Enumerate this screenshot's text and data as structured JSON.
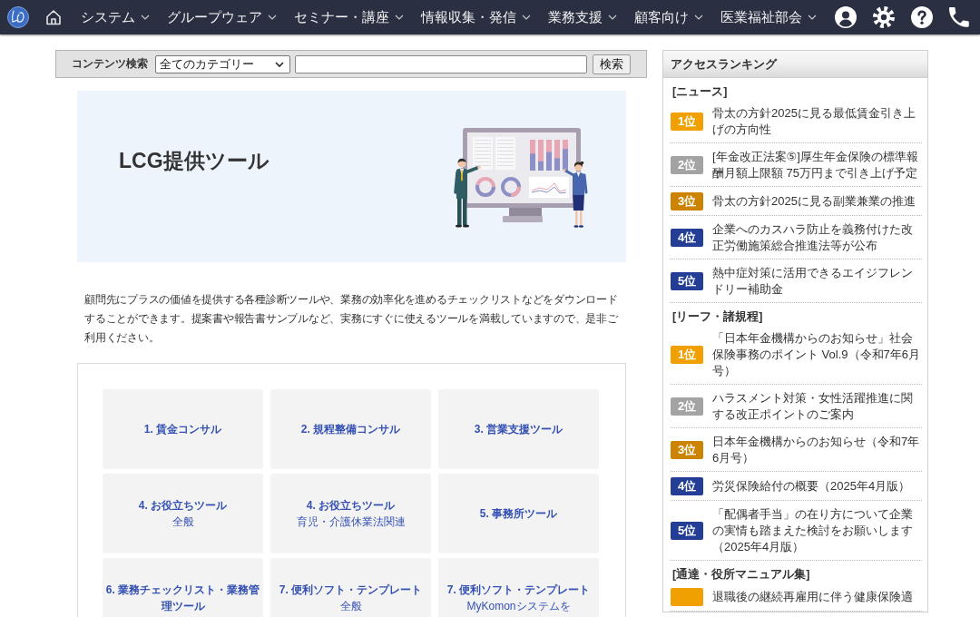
{
  "nav": {
    "items": [
      {
        "label": "システム"
      },
      {
        "label": "グループウェア"
      },
      {
        "label": "セミナー・講座"
      },
      {
        "label": "情報収集・発信"
      },
      {
        "label": "業務支援"
      },
      {
        "label": "顧客向け"
      },
      {
        "label": "医業福祉部会"
      }
    ]
  },
  "search": {
    "label": "コンテンツ検索",
    "category": "全てのカテゴリー",
    "button": "検索"
  },
  "hero": {
    "title": "LCG提供ツール"
  },
  "description": "顧問先にプラスの価値を提供する各種診断ツールや、業務の効率化を進めるチェックリストなどをダウンロードすることができます。提案書や報告書サンプルなど、実務にすぐに使えるツールを満載していますので、是非ご利用ください。",
  "tools": [
    {
      "title": "1. 賃金コンサル"
    },
    {
      "title": "2. 規程整備コンサル"
    },
    {
      "title": "3. 営業支援ツール"
    },
    {
      "title": "4. お役立ちツール",
      "subtitle": "全般"
    },
    {
      "title": "4. お役立ちツール",
      "subtitle": "育児・介護休業法関連"
    },
    {
      "title": "5. 事務所ツール"
    },
    {
      "title": "6. 業務チェックリスト・業務管理ツール"
    },
    {
      "title": "7. 便利ソフト・テンプレート",
      "subtitle": "全般"
    },
    {
      "title": "7. 便利ソフト・テンプレート",
      "subtitle": "MyKomonシステムを"
    }
  ],
  "ranking": {
    "title": "アクセスランキング",
    "sections": [
      {
        "heading": "[ニュース]",
        "items": [
          {
            "rank": "1位",
            "color": "#f0a000",
            "text": "骨太の方針2025に見る最低賃金引き上げの方向性"
          },
          {
            "rank": "2位",
            "color": "#a3a3a3",
            "text": "[年金改正法案⑤]厚生年金保険の標準報酬月額上限額 75万円まで引き上げ予定"
          },
          {
            "rank": "3位",
            "color": "#cc8400",
            "text": "骨太の方針2025に見る副業兼業の推進"
          },
          {
            "rank": "4位",
            "color": "#233e94",
            "text": "企業へのカスハラ防止を義務付けた改正労働施策総合推進法等が公布"
          },
          {
            "rank": "5位",
            "color": "#233e94",
            "text": "熱中症対策に活用できるエイジフレンドリー補助金"
          }
        ]
      },
      {
        "heading": "[リーフ・諸規程]",
        "items": [
          {
            "rank": "1位",
            "color": "#f0a000",
            "text": "「日本年金機構からのお知らせ」社会保険事務のポイント Vol.9（令和7年6月号）"
          },
          {
            "rank": "2位",
            "color": "#a3a3a3",
            "text": "ハラスメント対策・女性活躍推進に関する改正ポイントのご案内"
          },
          {
            "rank": "3位",
            "color": "#cc8400",
            "text": "日本年金機構からのお知らせ（令和7年6月号）"
          },
          {
            "rank": "4位",
            "color": "#233e94",
            "text": "労災保険給付の概要（2025年4月版）"
          },
          {
            "rank": "5位",
            "color": "#233e94",
            "text": "「配偶者手当」の在り方について企業の実情も踏まえた検討をお願いします（2025年4月版）"
          }
        ]
      },
      {
        "heading": "[通達・役所マニュアル集]",
        "items": [
          {
            "color": "#f0a000",
            "text": "退職後の継続再雇用に伴う健康保険適"
          }
        ]
      }
    ]
  }
}
